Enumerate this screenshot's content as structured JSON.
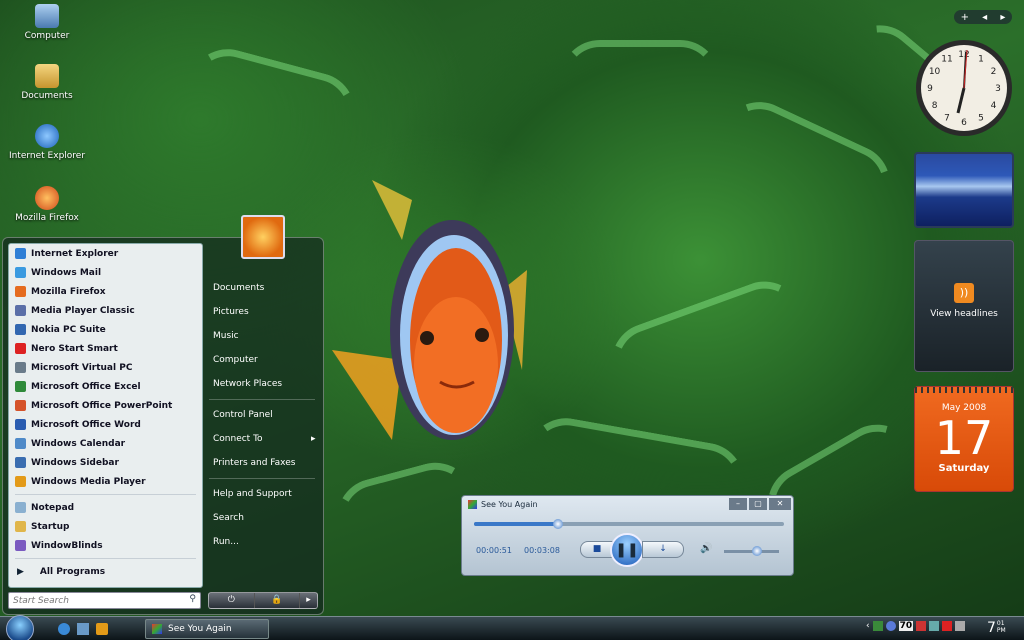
{
  "desktop_icons": [
    {
      "label": "Computer",
      "icon": "computer-icon",
      "color": "#6aa0d8"
    },
    {
      "label": "Documents",
      "icon": "folder-icon",
      "color": "#e0b64a"
    },
    {
      "label": "Internet Explorer",
      "icon": "ie-icon",
      "color": "#3a8ad8"
    },
    {
      "label": "Mozilla Firefox",
      "icon": "firefox-icon",
      "color": "#e86a1a"
    }
  ],
  "start_menu": {
    "pinned": [
      {
        "label": "Internet Explorer",
        "color": "#2f7fd6"
      },
      {
        "label": "Windows Mail",
        "color": "#3a9ae0"
      },
      {
        "label": "Mozilla Firefox",
        "color": "#e56b1f"
      },
      {
        "label": "Media Player Classic",
        "color": "#5b6fa8"
      },
      {
        "label": "Nokia PC Suite",
        "color": "#3267b0"
      },
      {
        "label": "Nero Start Smart",
        "color": "#d22"
      },
      {
        "label": "Microsoft Virtual PC",
        "color": "#6a7b8a"
      },
      {
        "label": "Microsoft Office Excel",
        "color": "#2f8a3a"
      },
      {
        "label": "Microsoft Office PowerPoint",
        "color": "#d5532a"
      },
      {
        "label": "Microsoft Office Word",
        "color": "#2a5cb0"
      },
      {
        "label": "Windows Calendar",
        "color": "#4f8ac8"
      },
      {
        "label": "Windows Sidebar",
        "color": "#3a6db0"
      },
      {
        "label": "Windows Media Player",
        "color": "#e39a18"
      }
    ],
    "recent": [
      {
        "label": "Notepad",
        "color": "#8ab0d0"
      },
      {
        "label": "Startup",
        "color": "#e0b64a"
      },
      {
        "label": "WindowBlinds",
        "color": "#7a5ac0"
      }
    ],
    "all_programs": "All Programs",
    "search_placeholder": "Start Search",
    "right_items_1": [
      "Documents",
      "Pictures",
      "Music",
      "Computer",
      "Network Places"
    ],
    "right_items_2": [
      "Control Panel",
      "Connect To",
      "Printers and Faxes"
    ],
    "right_items_3": [
      "Help and Support",
      "Search",
      "Run..."
    ]
  },
  "taskbar": {
    "task_label": "See You Again",
    "clock_hour": "7",
    "clock_min": "01",
    "clock_ampm": "PM",
    "tray_num": "70"
  },
  "gadgets": {
    "feed": "View headlines",
    "cal_month": "May 2008",
    "cal_day": "17",
    "cal_weekday": "Saturday"
  },
  "media_player": {
    "title": "See You Again",
    "elapsed": "00:00:51",
    "total": "00:03:08",
    "progress": 0.27,
    "volume": 0.6
  }
}
